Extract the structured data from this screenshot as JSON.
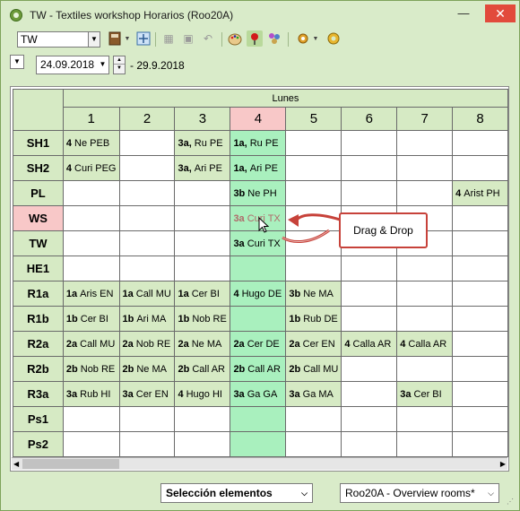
{
  "window": {
    "title": "TW - Textiles workshop  Horarios  (Roo20A)",
    "minimize": "—",
    "close": "✕"
  },
  "toolbar": {
    "combo_value": "TW"
  },
  "datebar": {
    "start_date": "24.09.2018",
    "end_date": "- 29.9.2018"
  },
  "timetable": {
    "day": "Lunes",
    "periods": [
      "1",
      "2",
      "3",
      "4",
      "5",
      "6",
      "7",
      "8"
    ],
    "selected_period": "4",
    "rows": [
      {
        "room": "SH1",
        "cells": [
          {
            "cls": "4",
            "rest": "Ne PEB"
          },
          null,
          {
            "cls": "3a,",
            "rest": "Ru PE"
          },
          {
            "cls": "1a,",
            "rest": "Ru PE"
          },
          null,
          null,
          null,
          null
        ]
      },
      {
        "room": "SH2",
        "cells": [
          {
            "cls": "4",
            "rest": "Curi PEG"
          },
          null,
          {
            "cls": "3a,",
            "rest": "Ari PE"
          },
          {
            "cls": "1a,",
            "rest": "Ari PE"
          },
          null,
          null,
          null,
          null
        ]
      },
      {
        "room": "PL",
        "cells": [
          null,
          null,
          null,
          {
            "cls": "3b",
            "rest": "Ne PH"
          },
          null,
          null,
          null,
          {
            "cls": "4",
            "rest": "Arist PH"
          }
        ]
      },
      {
        "room": "WS",
        "cells": [
          null,
          null,
          null,
          {
            "cls": "3a",
            "rest": "Curi TX",
            "ghost": true
          },
          null,
          null,
          null,
          null
        ]
      },
      {
        "room": "TW",
        "cells": [
          null,
          null,
          null,
          {
            "cls": "3a",
            "rest": "Curi TX",
            "red": true
          },
          null,
          null,
          null,
          null
        ]
      },
      {
        "room": "HE1",
        "cells": [
          null,
          null,
          null,
          null,
          null,
          null,
          null,
          null
        ]
      },
      {
        "room": "R1a",
        "cells": [
          {
            "cls": "1a",
            "rest": "Aris EN"
          },
          {
            "cls": "1a",
            "rest": "Call MU"
          },
          {
            "cls": "1a",
            "rest": "Cer BI"
          },
          {
            "cls": "4",
            "rest": "Hugo DE"
          },
          {
            "cls": "3b",
            "rest": "Ne MA"
          },
          null,
          null,
          null
        ]
      },
      {
        "room": "R1b",
        "cells": [
          {
            "cls": "1b",
            "rest": "Cer BI"
          },
          {
            "cls": "1b",
            "rest": "Ari MA"
          },
          {
            "cls": "1b",
            "rest": "Nob RE"
          },
          null,
          {
            "cls": "1b",
            "rest": "Rub DE"
          },
          null,
          null,
          null
        ]
      },
      {
        "room": "R2a",
        "cells": [
          {
            "cls": "2a",
            "rest": "Call MU"
          },
          {
            "cls": "2a",
            "rest": "Nob RE"
          },
          {
            "cls": "2a",
            "rest": "Ne MA"
          },
          {
            "cls": "2a",
            "rest": "Cer DE"
          },
          {
            "cls": "2a",
            "rest": "Cer EN"
          },
          {
            "cls": "4",
            "rest": "Calla AR"
          },
          {
            "cls": "4",
            "rest": "Calla AR"
          },
          null
        ]
      },
      {
        "room": "R2b",
        "cells": [
          {
            "cls": "2b",
            "rest": "Nob RE"
          },
          {
            "cls": "2b",
            "rest": "Ne MA"
          },
          {
            "cls": "2b",
            "rest": "Call AR"
          },
          {
            "cls": "2b",
            "rest": "Call AR"
          },
          {
            "cls": "2b",
            "rest": "Call MU"
          },
          null,
          null,
          null
        ]
      },
      {
        "room": "R3a",
        "cells": [
          {
            "cls": "3a",
            "rest": "Rub HI"
          },
          {
            "cls": "3a",
            "rest": "Cer EN"
          },
          {
            "cls": "4",
            "rest": "Hugo HI"
          },
          {
            "cls": "3a",
            "rest": "Ga GA"
          },
          {
            "cls": "3a",
            "rest": "Ga MA"
          },
          null,
          {
            "cls": "3a",
            "rest": "Cer BI"
          },
          null
        ]
      },
      {
        "room": "Ps1",
        "cells": [
          null,
          null,
          null,
          null,
          null,
          null,
          null,
          null
        ]
      },
      {
        "room": "Ps2",
        "cells": [
          null,
          null,
          null,
          null,
          null,
          null,
          null,
          null
        ]
      }
    ]
  },
  "callout": {
    "label": "Drag & Drop"
  },
  "statusbar": {
    "selection_label": "Selección elementos",
    "view_label": "Roo20A - Overview rooms*"
  },
  "colors": {
    "window_bg": "#d9ebc9",
    "selected_column": "#a9f0be",
    "dragged_lesson": "#f08585",
    "callout_border": "#c7423a"
  },
  "icons": [
    "combo-caret-icon",
    "notebook-icon",
    "dropdown-arrow-icon",
    "move-lesson-icon",
    "print-icon",
    "lock-icon",
    "undo-icon",
    "palette-icon",
    "pin-icon",
    "cluster-icon",
    "settings-icon",
    "gear-icon"
  ]
}
